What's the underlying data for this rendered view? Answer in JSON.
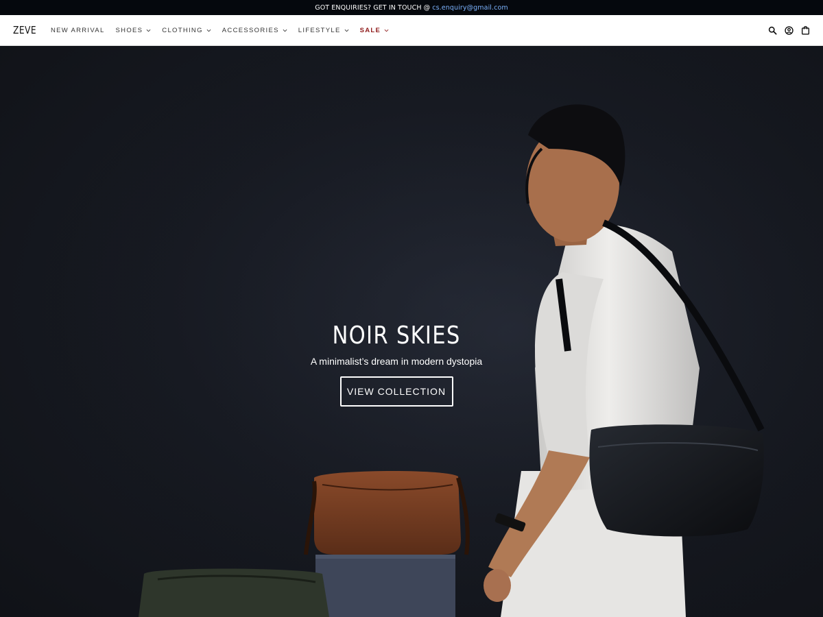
{
  "announcement": {
    "text": "GOT ENQUIRIES? GET IN TOUCH @",
    "email": "cs.enquiry@gmail.com"
  },
  "header": {
    "logo": "ZEVE",
    "nav": [
      {
        "label": "NEW ARRIVAL",
        "has_dropdown": false
      },
      {
        "label": "SHOES",
        "has_dropdown": true
      },
      {
        "label": "CLOTHING",
        "has_dropdown": true
      },
      {
        "label": "ACCESSORIES",
        "has_dropdown": true
      },
      {
        "label": "LIFESTYLE",
        "has_dropdown": true
      },
      {
        "label": "SALE",
        "has_dropdown": true
      }
    ],
    "icons": [
      "search-icon",
      "account-icon",
      "cart-icon"
    ]
  },
  "hero": {
    "title": "NOIR SKIES",
    "subtitle": "A minimalist’s dream in modern dystopia",
    "button_label": "VIEW COLLECTION"
  },
  "colors": {
    "announcement_bg": "#05080d",
    "link": "#7db4ff",
    "sale": "#8f1a1a",
    "hero_bg": "#171a22"
  }
}
